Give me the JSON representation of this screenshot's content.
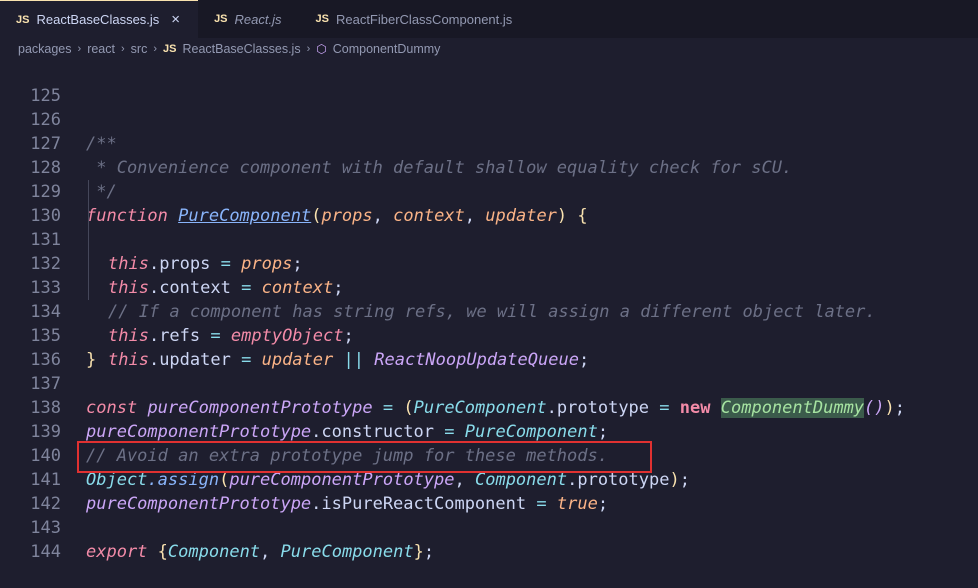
{
  "tabs": [
    {
      "icon": "JS",
      "label": "ReactBaseClasses.js",
      "close": "×"
    },
    {
      "icon": "JS",
      "label": "React.js"
    },
    {
      "icon": "JS",
      "label": "ReactFiberClassComponent.js"
    }
  ],
  "breadcrumbs": {
    "items": [
      "packages",
      "react",
      "src"
    ],
    "file_icon": "JS",
    "file": "ReactBaseClasses.js",
    "symbol": "ComponentDummy",
    "sep": "›"
  },
  "lines": {
    "n125": "125",
    "n126": "126",
    "n127": "127",
    "n128": "128",
    "n129": "129",
    "n130": "130",
    "n131": "131",
    "n132": "132",
    "n133": "133",
    "n134": "134",
    "n135": "135",
    "n136": "136",
    "n137": "137",
    "n138": "138",
    "n139": "139",
    "n140": "140",
    "n141": "141",
    "n142": "142",
    "n143": "143",
    "n144": "144"
  },
  "code": {
    "l126": "/**",
    "l127": " * Convenience component with default shallow equality check for sCU.",
    "l128": " */",
    "l129": {
      "kw": "function",
      "name": "PureComponent",
      "p1": "props",
      "p2": "context",
      "p3": "updater"
    },
    "l130": {
      "this": "this",
      "prop": ".props",
      "val": "props"
    },
    "l131": {
      "this": "this",
      "prop": ".context",
      "val": "context"
    },
    "l132": "// If a component has string refs, we will assign a different object later.",
    "l133": {
      "this": "this",
      "prop": ".refs",
      "val": "emptyObject"
    },
    "l134": {
      "this": "this",
      "prop": ".updater",
      "val": "updater",
      "op": "||",
      "alt": "ReactNoopUpdateQueue"
    },
    "l137": {
      "kw": "const",
      "name": "pureComponentPrototype",
      "cls": "PureComponent",
      "prop": ".prototype",
      "new": "new",
      "call": "ComponentDummy"
    },
    "l138": {
      "obj": "pureComponentPrototype",
      "prop": ".constructor",
      "val": "PureComponent"
    },
    "l139": "// Avoid an extra prototype jump for these methods.",
    "l140": {
      "obj": "Object",
      "fn": ".assign",
      "a1": "pureComponentPrototype",
      "a2": "Component",
      "prop": ".prototype"
    },
    "l141": {
      "obj": "pureComponentPrototype",
      "prop": ".isPureReactComponent",
      "val": "true"
    },
    "l143": {
      "kw": "export",
      "a": "Component",
      "b": "PureComponent"
    }
  },
  "highlight": {
    "line": "141",
    "color": "#e03131"
  }
}
